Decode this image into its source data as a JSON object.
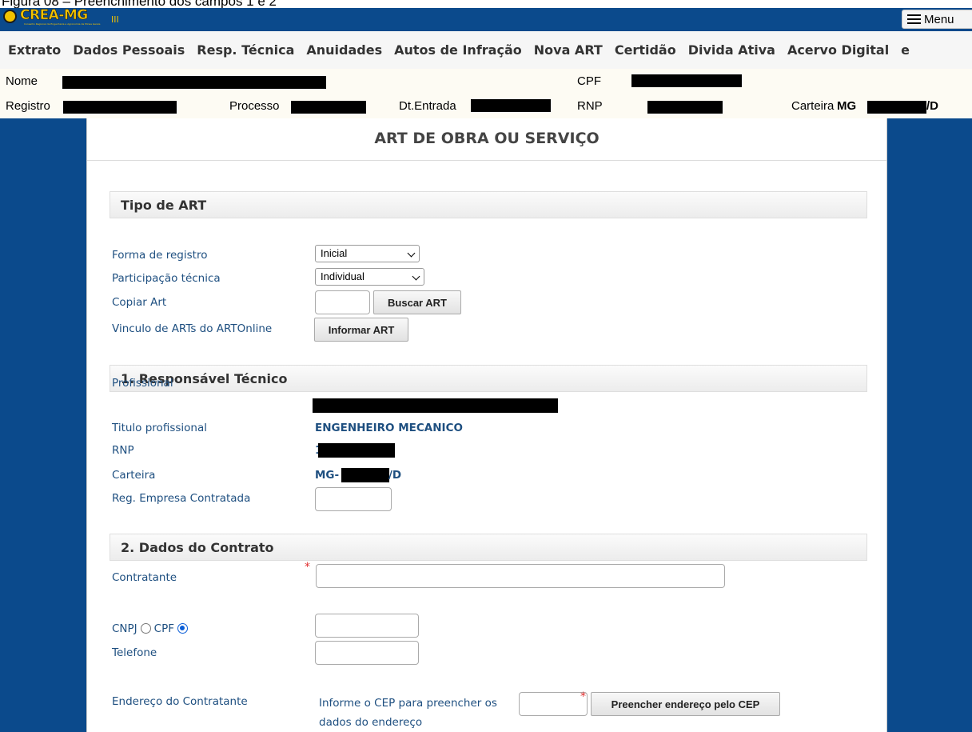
{
  "caption": "Figura 08 – Preenchimento dos campos 1 e 2",
  "header": {
    "logo_text": "CREA-MG",
    "logo_subtitle": "Conselho Regional de Engenharia e Agronomia de Minas Gerais",
    "logo_mark": "III",
    "menu_label": "Menu"
  },
  "nav": {
    "items": [
      "Extrato",
      "Dados Pessoais",
      "Resp. Técnica",
      "Anuidades",
      "Autos de Infração",
      "Nova ART",
      "Certidão",
      "Divida Ativa",
      "Acervo Digital",
      "e"
    ]
  },
  "info": {
    "nome_label": "Nome",
    "cpf_label": "CPF",
    "registro_label": "Registro",
    "processo_label": "Processo",
    "dt_entrada_label": "Dt.Entrada",
    "rnp_label": "RNP",
    "carteira_label": "Carteira",
    "carteira_prefix": "MG",
    "carteira_suffix": "/D"
  },
  "form": {
    "title": "ART DE OBRA OU SERVIÇO",
    "tipo": {
      "heading": "Tipo de ART",
      "forma_label": "Forma de registro",
      "forma_value": "Inicial",
      "participacao_label": "Participação técnica",
      "participacao_value": "Individual",
      "copiar_label": "Copiar Art",
      "buscar_button": "Buscar ART",
      "vinculo_label": "Vinculo de ARTs do ARTOnline",
      "informar_button": "Informar ART"
    },
    "responsavel": {
      "heading": "1. Responsável Técnico",
      "profissional_label": "Profissional",
      "titulo_label": "Titulo profissional",
      "titulo_value": "ENGENHEIRO MECANICO",
      "rnp_label": "RNP",
      "rnp_prefix": "1",
      "carteira_label": "Carteira",
      "carteira_prefix": "MG-",
      "carteira_suffix": "/D",
      "reg_empresa_label": "Reg. Empresa Contratada"
    },
    "contrato": {
      "heading": "2. Dados do Contrato",
      "contratante_label": "Contratante",
      "required_mark": "*",
      "cnpj_label": "CNPJ",
      "cpf_label": "CPF",
      "selected_doc_type": "CPF",
      "telefone_label": "Telefone",
      "endereco_label": "Endereço do Contratante",
      "cep_hint_line1": "Informe o CEP para preencher os",
      "cep_hint_line2": "dados do endereço",
      "cep_button": "Preencher endereço pelo CEP"
    }
  },
  "colors": {
    "brand_blue": "#0b4a8c",
    "brand_yellow": "#f2c200",
    "label_blue": "#1e4f80",
    "required_red": "#e03030"
  }
}
